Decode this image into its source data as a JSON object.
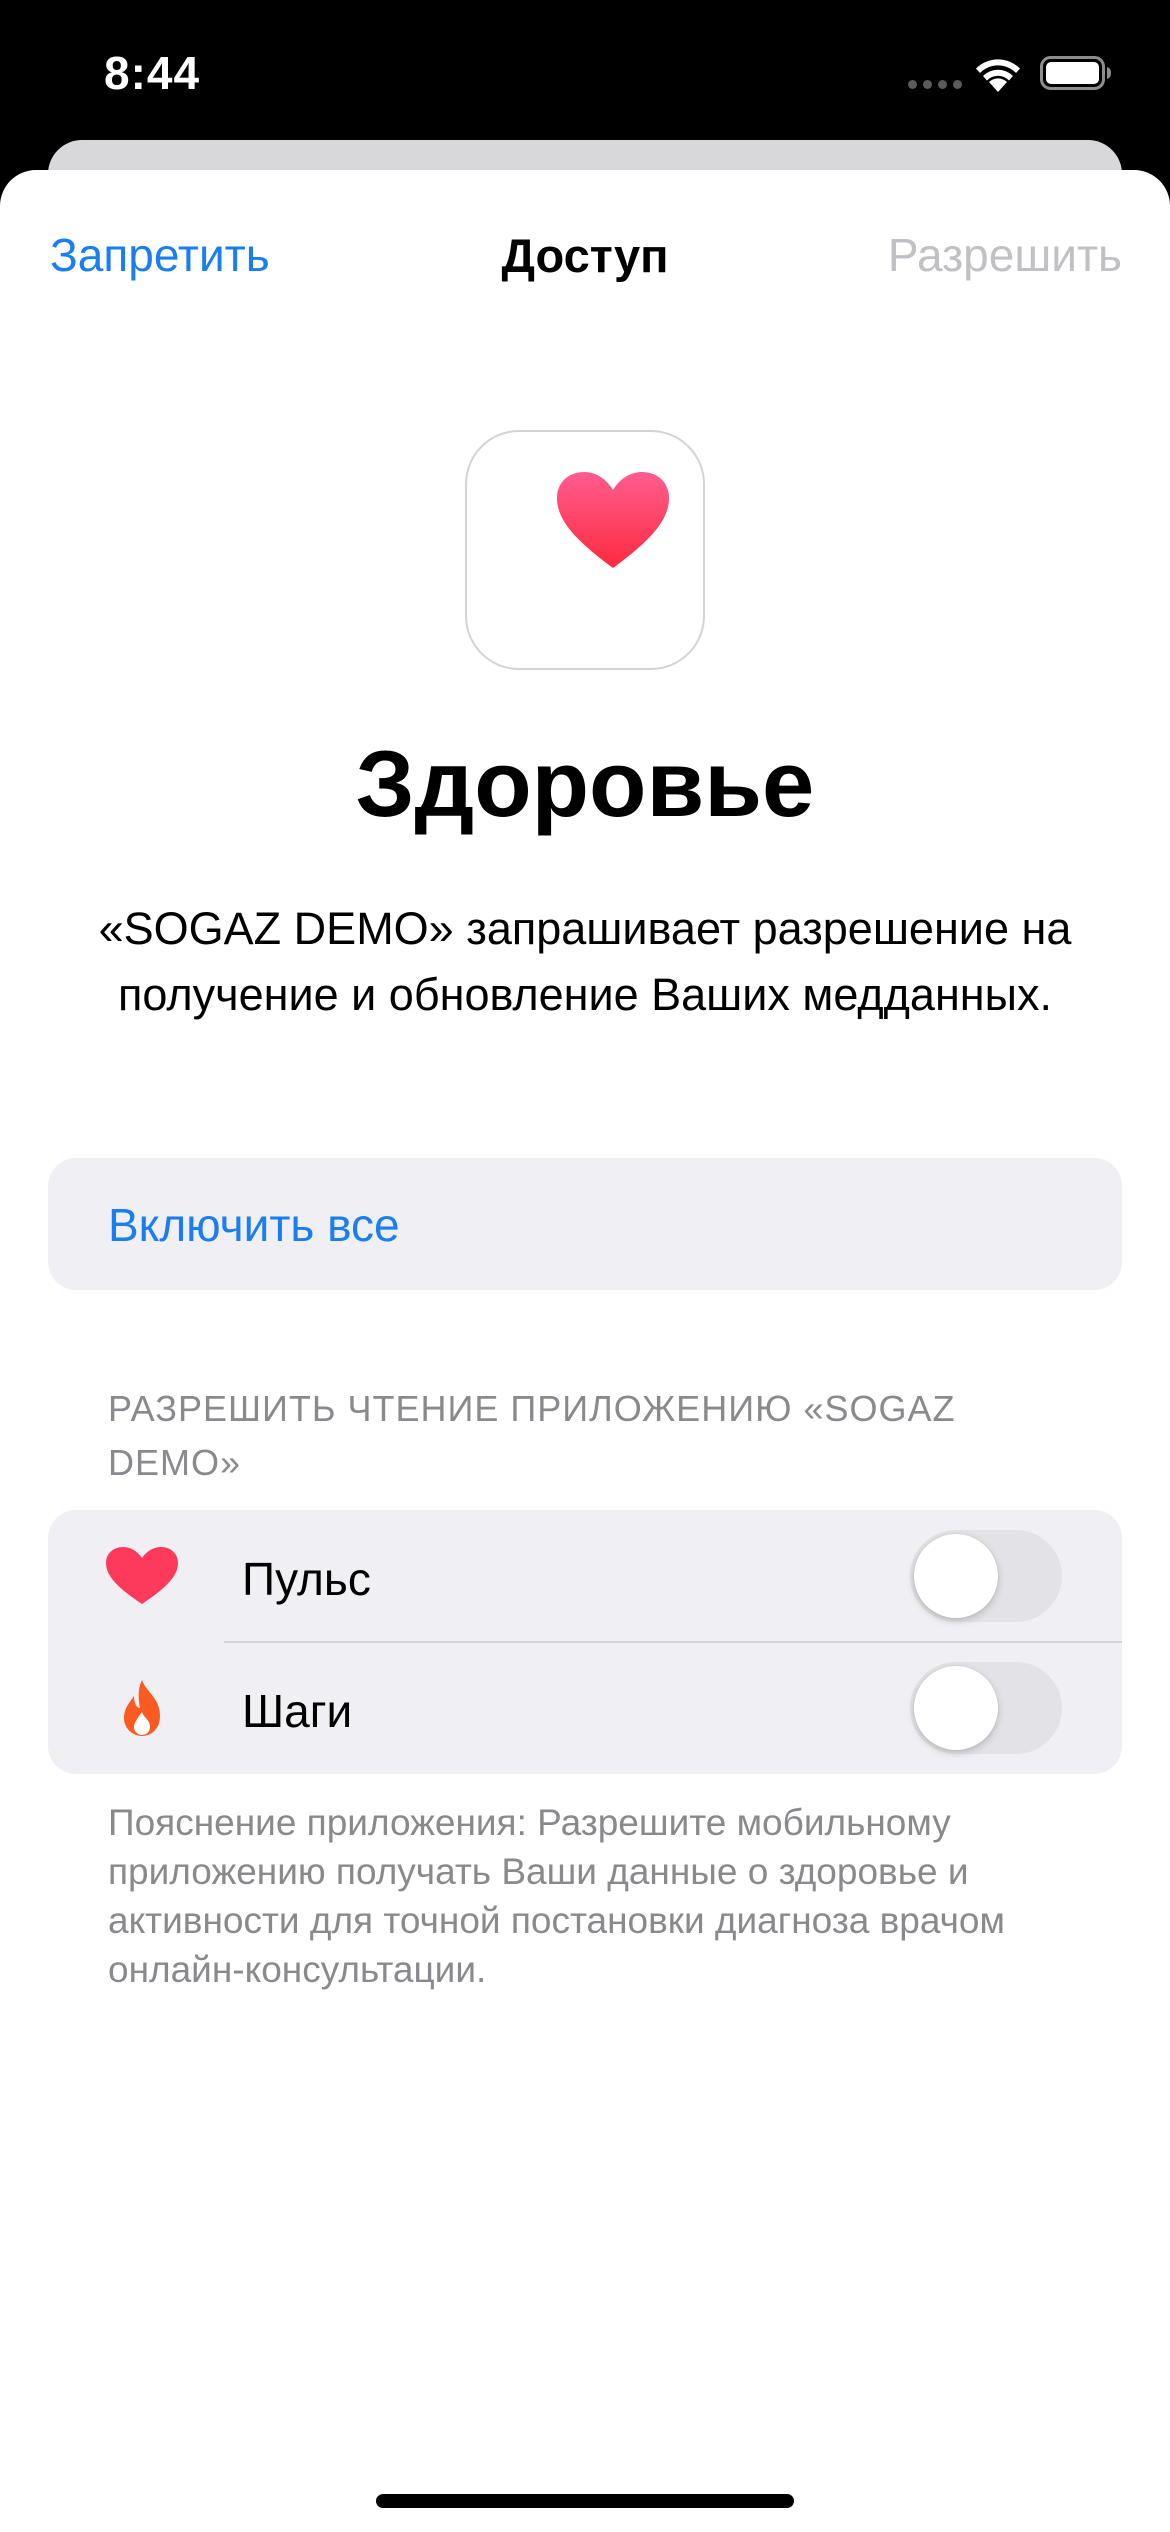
{
  "status_bar": {
    "time": "8:44",
    "icons": [
      "cellular-dots-icon",
      "wifi-icon",
      "battery-icon"
    ]
  },
  "nav": {
    "left_label": "Запретить",
    "title": "Доступ",
    "right_label": "Разрешить"
  },
  "app": {
    "icon": "health-heart-icon",
    "name": "Здоровье"
  },
  "description": "«SOGAZ DEMO» запрашивает разрешение на получение и обновление Ваших медданных.",
  "enable_all": {
    "label": "Включить все"
  },
  "read_section": {
    "header": "РАЗРЕШИТЬ ЧТЕНИЕ ПРИЛОЖЕНИЮ «SOGAZ DEMO»",
    "items": [
      {
        "label": "Пульс",
        "icon": "heart-icon",
        "enabled": false
      },
      {
        "label": "Шаги",
        "icon": "flame-icon",
        "enabled": false
      }
    ]
  },
  "footnote": "Пояснение приложения: Разрешите мобильному приложению получать Ваши данные о здоровье и активности для точной постановки диагноза врачом онлайн-консультации.",
  "colors": {
    "accent": "#1a7ef0",
    "disabled": "#c1c1c5",
    "heart": "#fd3a5c",
    "flame": "#fb5a20",
    "group_bg": "#f0f0f4"
  }
}
